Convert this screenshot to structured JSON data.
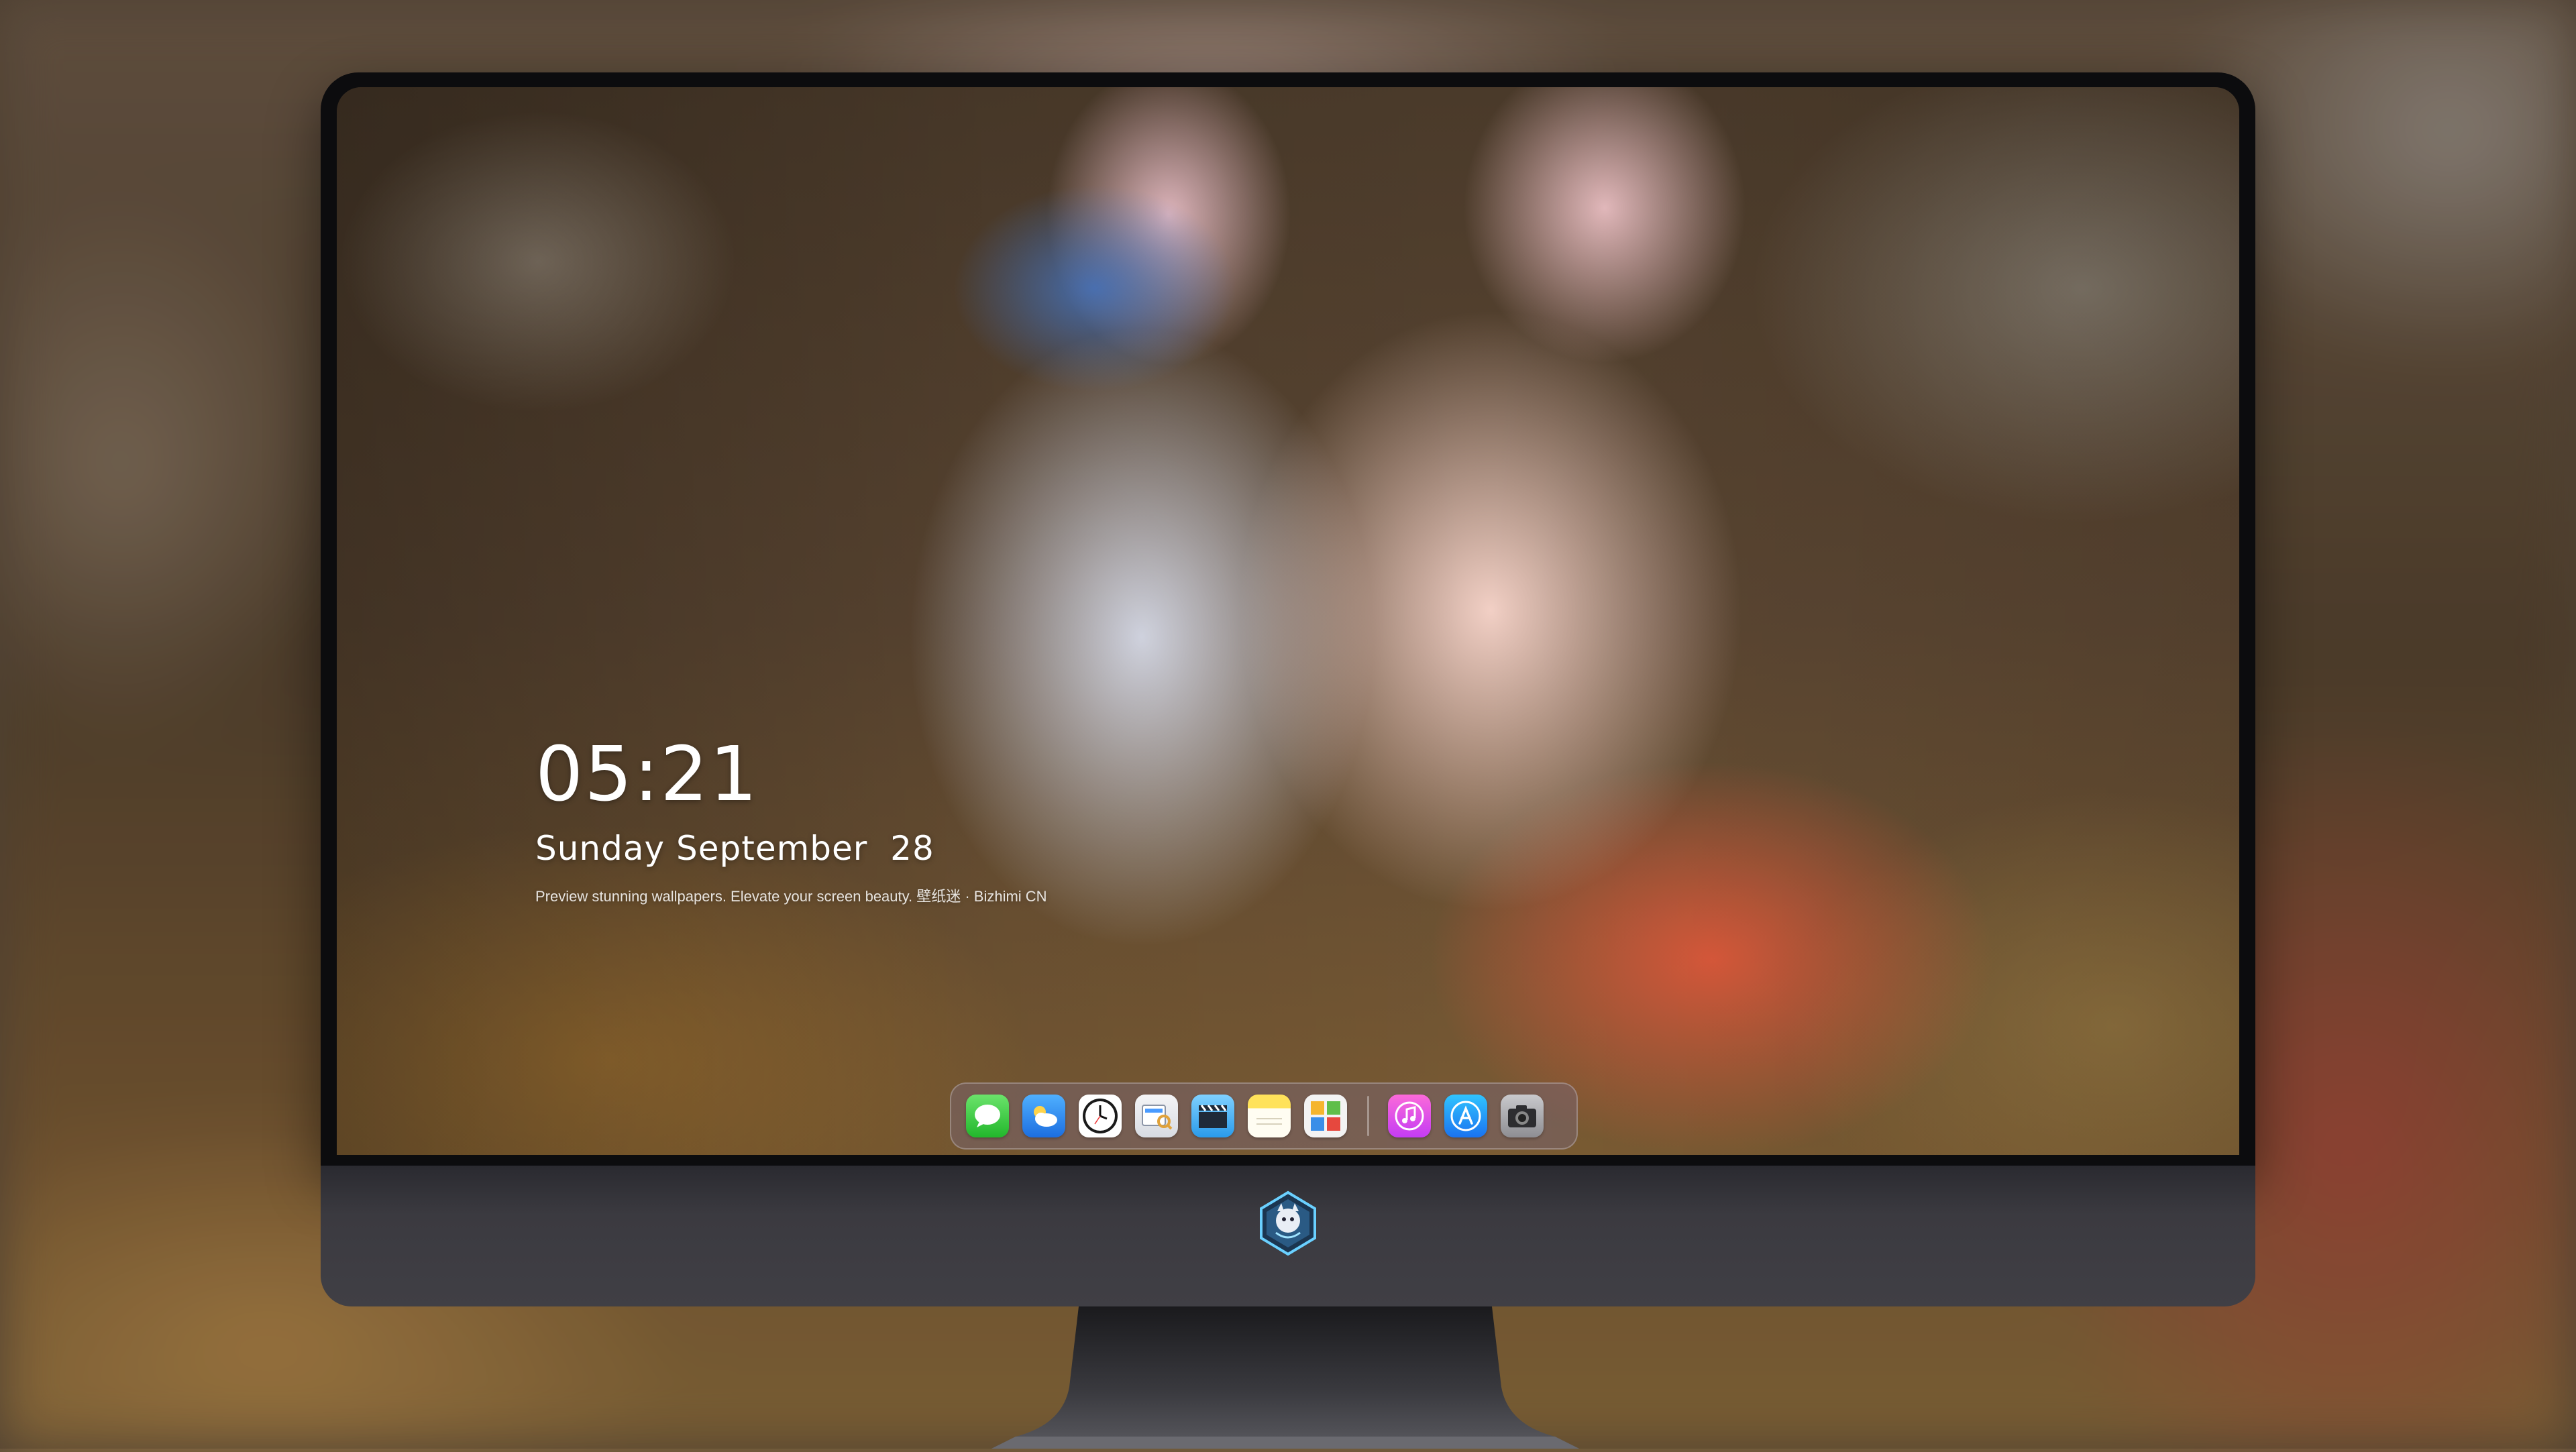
{
  "lockscreen": {
    "time": "05:21",
    "date": "Sunday September  28",
    "tagline": "Preview stunning wallpapers. Elevate your screen beauty. 壁纸迷 · Bizhimi CN"
  },
  "dock": {
    "items": [
      {
        "id": "messages",
        "icon": "messages-icon"
      },
      {
        "id": "weather",
        "icon": "weather-icon"
      },
      {
        "id": "clock",
        "icon": "clock-icon"
      },
      {
        "id": "preview",
        "icon": "preview-icon"
      },
      {
        "id": "clips",
        "icon": "clapperboard-icon"
      },
      {
        "id": "notes",
        "icon": "notes-icon"
      },
      {
        "id": "photos",
        "icon": "photos-icon"
      },
      {
        "id": "music",
        "icon": "music-icon"
      },
      {
        "id": "app-store",
        "icon": "app-store-icon"
      },
      {
        "id": "camera",
        "icon": "camera-icon"
      }
    ]
  },
  "colors": {
    "bezel": "#0c0c0e",
    "chin": "#3b3a40",
    "dock_bg": "#786e78",
    "text": "#ffffff"
  }
}
